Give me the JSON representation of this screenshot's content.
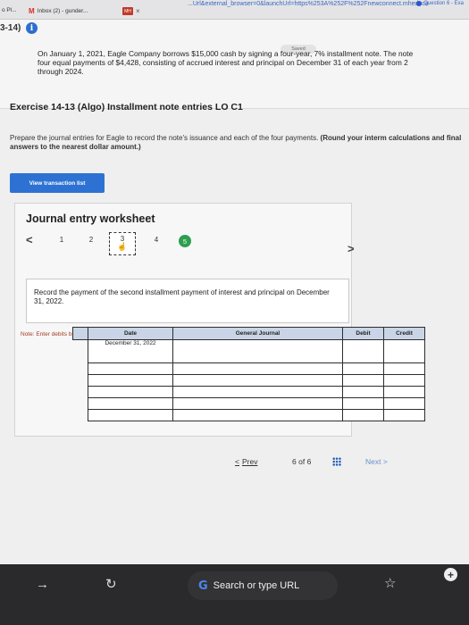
{
  "browser": {
    "tab1_label": "o Pl...",
    "tab2_label": "Inbox (2) - gunder...",
    "tab2_icon": "M",
    "tab3_icon": "MH",
    "close_glyph": "×",
    "url_prefix": "...",
    "url_text": "Url&external_browser=0&launchUrl=https%253A%252F%252Fnewconnect.mheduca",
    "question_label": "Question 6 - Exa"
  },
  "question": {
    "number": "3-14)",
    "info_glyph": "i",
    "saved_label": "Saved",
    "problem_text": "On January 1, 2021, Eagle Company borrows $15,000 cash by signing a four-year, 7% installment note. The note\nfour equal payments of $4,428, consisting of accrued interest and principal on December 31 of each year from 2\nthrough 2024.",
    "exercise_title": "Exercise 14-13 (Algo) Installment note entries LO C1",
    "instructions": "Prepare the journal entries for Eagle to record the note's issuance and each of the four payments.",
    "instructions_bold": "(Round your interm calculations and final answers to the nearest dollar amount.)",
    "view_button": "View transaction list"
  },
  "worksheet": {
    "title": "Journal entry worksheet",
    "prev_glyph": "<",
    "next_glyph": ">",
    "steps": [
      "1",
      "2",
      "3",
      "4",
      "5"
    ],
    "current_step": "3",
    "task_text": "Record the payment of the second installment payment of interest and principal on December 31, 2022.",
    "note": "Note: Enter debits before credits.",
    "columns": [
      "Date",
      "General Journal",
      "Debit",
      "Credit"
    ],
    "rows": [
      {
        "date": "December 31, 2022",
        "account": "",
        "debit": "",
        "credit": ""
      },
      {
        "date": "",
        "account": "",
        "debit": "",
        "credit": ""
      },
      {
        "date": "",
        "account": "",
        "debit": "",
        "credit": ""
      },
      {
        "date": "",
        "account": "",
        "debit": "",
        "credit": ""
      },
      {
        "date": "",
        "account": "",
        "debit": "",
        "credit": ""
      },
      {
        "date": "",
        "account": "",
        "debit": "",
        "credit": ""
      }
    ]
  },
  "pagination": {
    "prev_label": "Prev",
    "page_current": "6",
    "page_of": "of",
    "page_total": "6",
    "next_label": "Next"
  },
  "mobile_bar": {
    "search_placeholder": "Search or type URL",
    "google_glyph": "G"
  },
  "colors": {
    "accent": "#2d72d2",
    "header_fill": "#c9d4e6",
    "note_text": "#a33b26",
    "step_done": "#2e9e4f"
  }
}
